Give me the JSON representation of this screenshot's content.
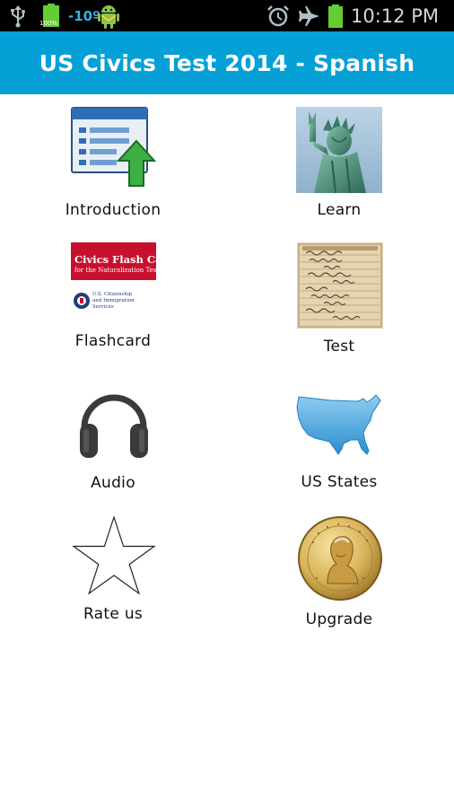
{
  "status_bar": {
    "battery_small_label": "100%",
    "temperature": "-10º",
    "time": "10:12 PM",
    "icons": [
      "usb-icon",
      "battery-icon",
      "android-icon",
      "alarm-icon",
      "airplane-mode-icon",
      "battery-full-icon"
    ],
    "colors": {
      "background": "#000000",
      "text": "#cfd8dc",
      "battery_green": "#66cc33",
      "temperature_blue": "#33b5e5"
    }
  },
  "header": {
    "title": "US Civics Test 2014 - Spanish",
    "background": "#05a0d6"
  },
  "menu": {
    "items": [
      {
        "label": "Introduction",
        "icon": "introduction-list-upload-icon"
      },
      {
        "label": "Learn",
        "icon": "statue-of-liberty-image"
      },
      {
        "label": "Flashcard",
        "icon": "civics-flash-cards-cover"
      },
      {
        "label": "Test",
        "icon": "registration-card-document-image"
      },
      {
        "label": "Audio",
        "icon": "headphones-icon"
      },
      {
        "label": "US States",
        "icon": "us-map-icon"
      },
      {
        "label": "Rate us",
        "icon": "star-outline-icon"
      },
      {
        "label": "Upgrade",
        "icon": "washington-dollar-coin-icon"
      }
    ],
    "flashcard_cover": {
      "title_line1": "Civics Flash Cards",
      "title_line2": "for the Naturalization Test",
      "agency_line1": "U.S. Citizenship",
      "agency_line2": "and Immigration",
      "agency_line3": "Services"
    }
  }
}
